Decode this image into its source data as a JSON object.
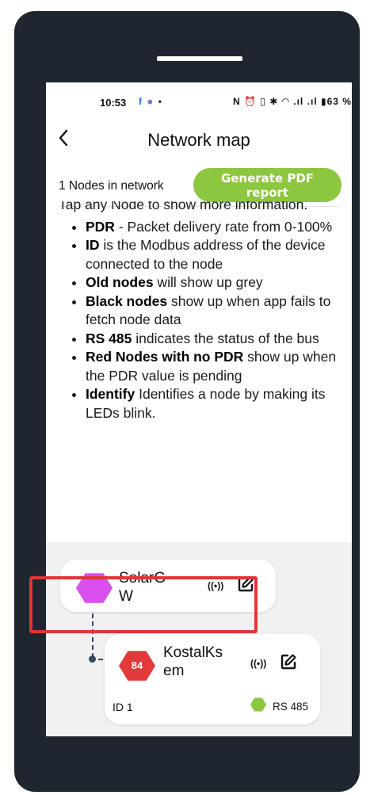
{
  "status_bar": {
    "time": "10:53",
    "left_icons": "f ⦁ • ",
    "right_icons": "N ⏰ ▯ ✱ ◠ .ıl .ıl",
    "battery": "63 %"
  },
  "header": {
    "back_icon": "chevron-left-icon",
    "title": "Network map"
  },
  "toolbar": {
    "nodes_count": "1 Nodes in network",
    "generate_pdf_label": "Generate PDF report",
    "accent_color": "#8dc63f"
  },
  "info": {
    "intro": "Tap any Node to show more information.",
    "items": [
      {
        "bold": "PDR",
        "text": " - Packet delivery rate from 0-100%"
      },
      {
        "bold": "ID",
        "text": " is the Modbus address of the device connected to the node"
      },
      {
        "bold": "Old nodes",
        "text": " will show up grey"
      },
      {
        "bold": "Black nodes",
        "text": " show up when app fails to fetch node data"
      },
      {
        "bold": "RS 485",
        "text": " indicates the status of the bus"
      },
      {
        "bold": "Red Nodes with no PDR",
        "text": " show up when the PDR value is pending"
      },
      {
        "bold": "Identify",
        "text": " Identifies a node by making its LEDs blink."
      }
    ]
  },
  "nodes": {
    "parent": {
      "name": "SolarGW",
      "name_line1": "SolarG",
      "name_line2": "W",
      "color": "#d94fef",
      "identify_icon": "((•))"
    },
    "child": {
      "name": "KostalKsem",
      "name_line1": "KostalKs",
      "name_line2": "em",
      "pdr": "84",
      "color": "#e03a3a",
      "identify_icon": "((•))",
      "id_label": "ID  1",
      "rs485_label": "RS 485",
      "rs485_color": "#8dc63f"
    }
  }
}
